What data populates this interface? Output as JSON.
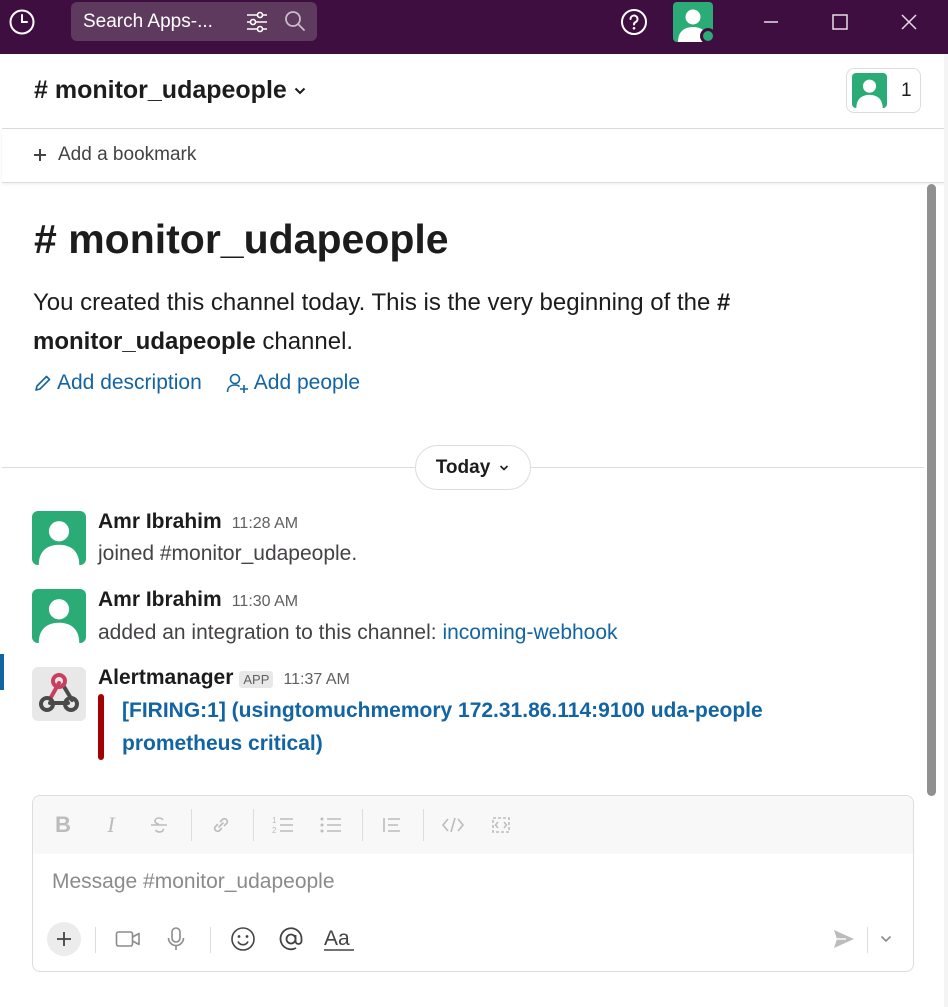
{
  "titlebar": {
    "search_placeholder": "Search Apps-...",
    "background": "#3f0e40",
    "icons": [
      "history-icon",
      "filter-icon",
      "search-icon",
      "help-icon",
      "user-avatar",
      "minimize-icon",
      "maximize-icon",
      "close-icon"
    ]
  },
  "channel": {
    "name": "# monitor_udapeople",
    "member_count": "1",
    "bookmark_label": "Add a bookmark"
  },
  "intro": {
    "title": "monitor_udapeople",
    "line_prefix": "You created this channel today. This is the very beginning of the",
    "channel_ref": "# monitor_udapeople",
    "line_suffix": "channel.",
    "add_description": "Add description",
    "add_people": "Add people"
  },
  "divider": {
    "label": "Today"
  },
  "messages": [
    {
      "author": "Amr Ibrahim",
      "time": "11:28 AM",
      "text": "joined #monitor_udapeople."
    },
    {
      "author": "Amr Ibrahim",
      "time": "11:30 AM",
      "text": "added an integration to this channel:",
      "link": "incoming-webhook"
    },
    {
      "author": "Alertmanager",
      "badge": "APP",
      "time": "11:37 AM",
      "alert_line1": "[FIRING:1]  (usingtomuchmemory 172.31.86.114:9100 uda-people",
      "alert_line2": "prometheus critical)",
      "alert_color": "#a30200"
    }
  ],
  "composer": {
    "placeholder": "Message #monitor_udapeople",
    "format_tools": [
      "bold-icon",
      "italic-icon",
      "strikethrough-icon",
      "link-icon",
      "ordered-list-icon",
      "bulleted-list-icon",
      "blockquote-icon",
      "code-icon",
      "code-block-icon"
    ],
    "bottom_tools": [
      "plus-icon",
      "video-icon",
      "microphone-icon",
      "emoji-icon",
      "mention-icon",
      "formatting-icon",
      "send-icon",
      "send-options-icon"
    ]
  },
  "colors": {
    "link": "#1264a3",
    "avatar_green": "#2bac76"
  }
}
